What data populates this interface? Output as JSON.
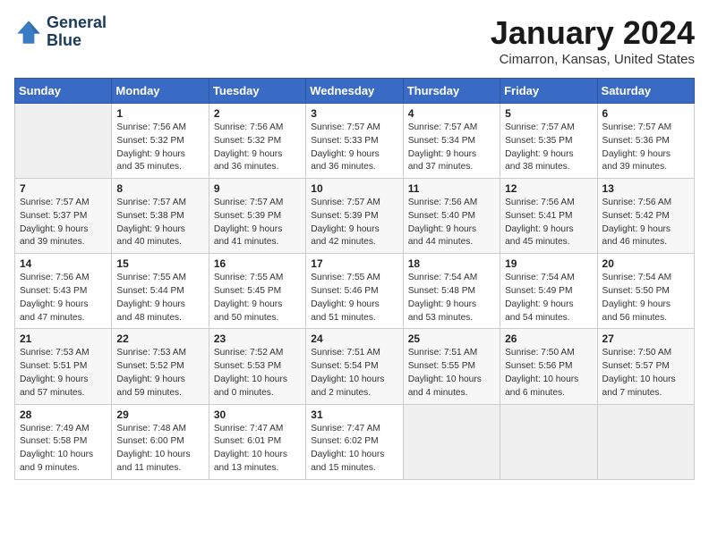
{
  "header": {
    "logo_line1": "General",
    "logo_line2": "Blue",
    "month": "January 2024",
    "location": "Cimarron, Kansas, United States"
  },
  "days_of_week": [
    "Sunday",
    "Monday",
    "Tuesday",
    "Wednesday",
    "Thursday",
    "Friday",
    "Saturday"
  ],
  "weeks": [
    [
      {
        "day": "",
        "info": ""
      },
      {
        "day": "1",
        "info": "Sunrise: 7:56 AM\nSunset: 5:32 PM\nDaylight: 9 hours\nand 35 minutes."
      },
      {
        "day": "2",
        "info": "Sunrise: 7:56 AM\nSunset: 5:32 PM\nDaylight: 9 hours\nand 36 minutes."
      },
      {
        "day": "3",
        "info": "Sunrise: 7:57 AM\nSunset: 5:33 PM\nDaylight: 9 hours\nand 36 minutes."
      },
      {
        "day": "4",
        "info": "Sunrise: 7:57 AM\nSunset: 5:34 PM\nDaylight: 9 hours\nand 37 minutes."
      },
      {
        "day": "5",
        "info": "Sunrise: 7:57 AM\nSunset: 5:35 PM\nDaylight: 9 hours\nand 38 minutes."
      },
      {
        "day": "6",
        "info": "Sunrise: 7:57 AM\nSunset: 5:36 PM\nDaylight: 9 hours\nand 39 minutes."
      }
    ],
    [
      {
        "day": "7",
        "info": "Sunrise: 7:57 AM\nSunset: 5:37 PM\nDaylight: 9 hours\nand 39 minutes."
      },
      {
        "day": "8",
        "info": "Sunrise: 7:57 AM\nSunset: 5:38 PM\nDaylight: 9 hours\nand 40 minutes."
      },
      {
        "day": "9",
        "info": "Sunrise: 7:57 AM\nSunset: 5:39 PM\nDaylight: 9 hours\nand 41 minutes."
      },
      {
        "day": "10",
        "info": "Sunrise: 7:57 AM\nSunset: 5:39 PM\nDaylight: 9 hours\nand 42 minutes."
      },
      {
        "day": "11",
        "info": "Sunrise: 7:56 AM\nSunset: 5:40 PM\nDaylight: 9 hours\nand 44 minutes."
      },
      {
        "day": "12",
        "info": "Sunrise: 7:56 AM\nSunset: 5:41 PM\nDaylight: 9 hours\nand 45 minutes."
      },
      {
        "day": "13",
        "info": "Sunrise: 7:56 AM\nSunset: 5:42 PM\nDaylight: 9 hours\nand 46 minutes."
      }
    ],
    [
      {
        "day": "14",
        "info": "Sunrise: 7:56 AM\nSunset: 5:43 PM\nDaylight: 9 hours\nand 47 minutes."
      },
      {
        "day": "15",
        "info": "Sunrise: 7:55 AM\nSunset: 5:44 PM\nDaylight: 9 hours\nand 48 minutes."
      },
      {
        "day": "16",
        "info": "Sunrise: 7:55 AM\nSunset: 5:45 PM\nDaylight: 9 hours\nand 50 minutes."
      },
      {
        "day": "17",
        "info": "Sunrise: 7:55 AM\nSunset: 5:46 PM\nDaylight: 9 hours\nand 51 minutes."
      },
      {
        "day": "18",
        "info": "Sunrise: 7:54 AM\nSunset: 5:48 PM\nDaylight: 9 hours\nand 53 minutes."
      },
      {
        "day": "19",
        "info": "Sunrise: 7:54 AM\nSunset: 5:49 PM\nDaylight: 9 hours\nand 54 minutes."
      },
      {
        "day": "20",
        "info": "Sunrise: 7:54 AM\nSunset: 5:50 PM\nDaylight: 9 hours\nand 56 minutes."
      }
    ],
    [
      {
        "day": "21",
        "info": "Sunrise: 7:53 AM\nSunset: 5:51 PM\nDaylight: 9 hours\nand 57 minutes."
      },
      {
        "day": "22",
        "info": "Sunrise: 7:53 AM\nSunset: 5:52 PM\nDaylight: 9 hours\nand 59 minutes."
      },
      {
        "day": "23",
        "info": "Sunrise: 7:52 AM\nSunset: 5:53 PM\nDaylight: 10 hours\nand 0 minutes."
      },
      {
        "day": "24",
        "info": "Sunrise: 7:51 AM\nSunset: 5:54 PM\nDaylight: 10 hours\nand 2 minutes."
      },
      {
        "day": "25",
        "info": "Sunrise: 7:51 AM\nSunset: 5:55 PM\nDaylight: 10 hours\nand 4 minutes."
      },
      {
        "day": "26",
        "info": "Sunrise: 7:50 AM\nSunset: 5:56 PM\nDaylight: 10 hours\nand 6 minutes."
      },
      {
        "day": "27",
        "info": "Sunrise: 7:50 AM\nSunset: 5:57 PM\nDaylight: 10 hours\nand 7 minutes."
      }
    ],
    [
      {
        "day": "28",
        "info": "Sunrise: 7:49 AM\nSunset: 5:58 PM\nDaylight: 10 hours\nand 9 minutes."
      },
      {
        "day": "29",
        "info": "Sunrise: 7:48 AM\nSunset: 6:00 PM\nDaylight: 10 hours\nand 11 minutes."
      },
      {
        "day": "30",
        "info": "Sunrise: 7:47 AM\nSunset: 6:01 PM\nDaylight: 10 hours\nand 13 minutes."
      },
      {
        "day": "31",
        "info": "Sunrise: 7:47 AM\nSunset: 6:02 PM\nDaylight: 10 hours\nand 15 minutes."
      },
      {
        "day": "",
        "info": ""
      },
      {
        "day": "",
        "info": ""
      },
      {
        "day": "",
        "info": ""
      }
    ]
  ]
}
